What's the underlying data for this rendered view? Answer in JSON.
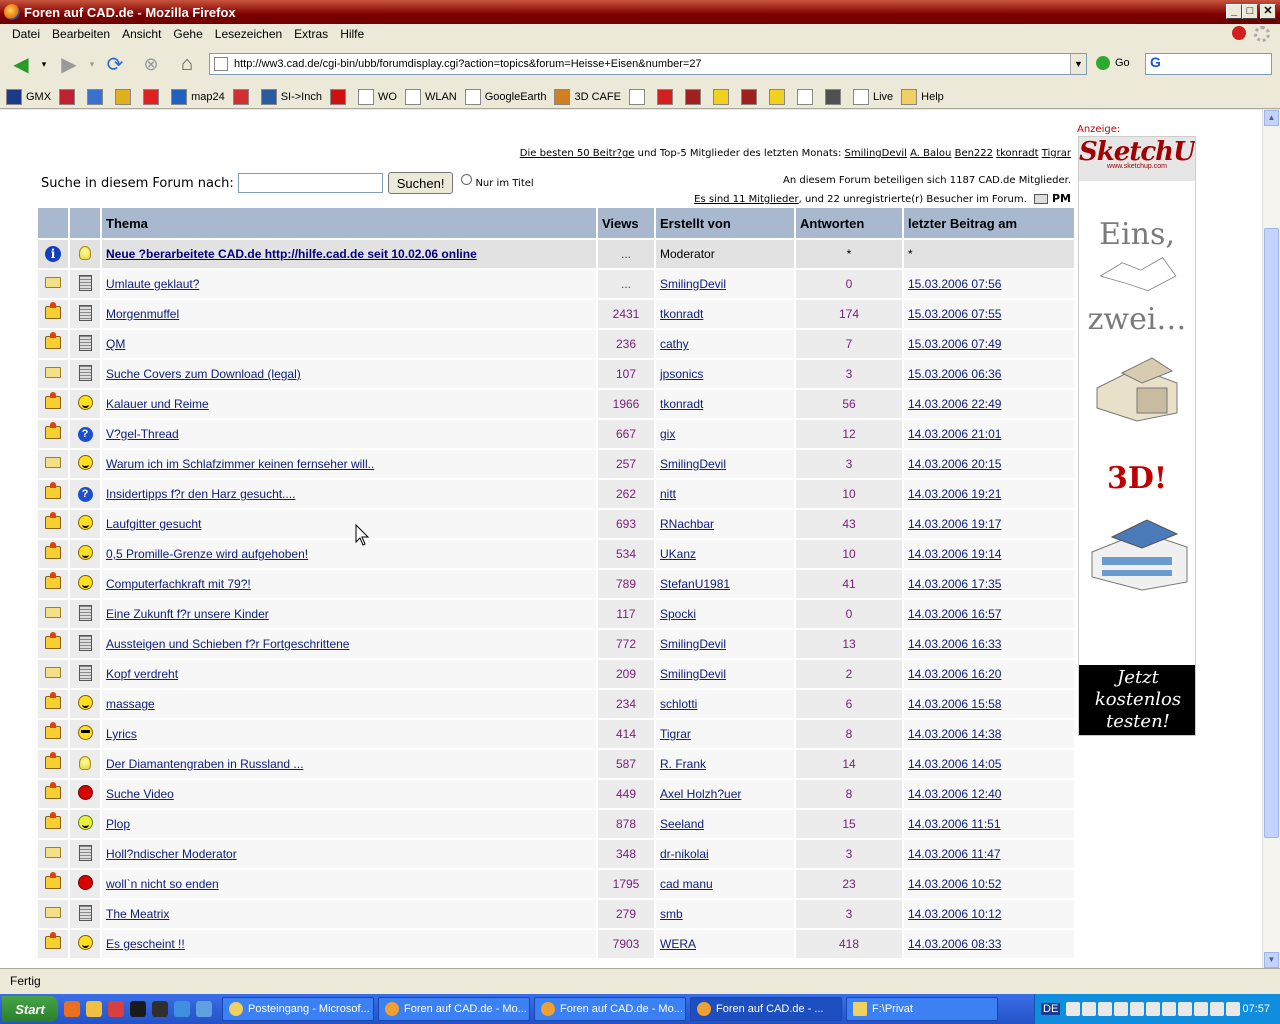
{
  "window": {
    "title": "Foren auf CAD.de - Mozilla Firefox"
  },
  "menu": [
    "Datei",
    "Bearbeiten",
    "Ansicht",
    "Gehe",
    "Lesezeichen",
    "Extras",
    "Hilfe"
  ],
  "navbar": {
    "url": "http://ww3.cad.de/cgi-bin/ubb/forumdisplay.cgi?action=topics&forum=Heisse+Eisen&number=27",
    "go_label": "Go"
  },
  "bookmarks": [
    {
      "label": "GMX",
      "icon": "gmx-icon"
    },
    {
      "label": "",
      "icon": "uk-flag-icon"
    },
    {
      "label": "",
      "icon": "google-icon"
    },
    {
      "label": "",
      "icon": "imdb-icon"
    },
    {
      "label": "",
      "icon": "sparkasse-icon"
    },
    {
      "label": "map24",
      "icon": "map24-icon"
    },
    {
      "label": "",
      "icon": "ebay-icon"
    },
    {
      "label": "SI->Inch",
      "icon": "si-icon"
    },
    {
      "label": "",
      "icon": "db-icon"
    },
    {
      "label": "WO",
      "icon": "page-icon"
    },
    {
      "label": "WLAN",
      "icon": "page-icon"
    },
    {
      "label": "GoogleEarth",
      "icon": "page-icon"
    },
    {
      "label": "3D CAFE",
      "icon": "3dcafe-icon"
    },
    {
      "label": "",
      "icon": "wikipedia-icon"
    },
    {
      "label": "",
      "icon": "bb-icon"
    },
    {
      "label": "",
      "icon": "film-icon"
    },
    {
      "label": "",
      "icon": "smiley-icon"
    },
    {
      "label": "",
      "icon": "film-icon"
    },
    {
      "label": "",
      "icon": "smiley-icon"
    },
    {
      "label": "",
      "icon": "page-icon"
    },
    {
      "label": "",
      "icon": "scan-icon"
    },
    {
      "label": "Live",
      "icon": "page-icon"
    },
    {
      "label": "Help",
      "icon": "folder-icon"
    }
  ],
  "forum": {
    "top_link": "Die besten 50 Beitr?ge",
    "top_text": " und Top-5 Mitglieder des letzten Monats: ",
    "top_members": [
      "SmilingDevil",
      "A. Balou",
      "Ben222",
      "tkonradt",
      "Tigrar"
    ],
    "online_line1": "An diesem Forum beteiligen sich 1187 CAD.de Mitglieder.",
    "online_link": "Es sind 11 Mitglieder",
    "online_rest": ", und 22 unregistrierte(r) Besucher im Forum.",
    "pm_label": "PM",
    "search_label": "Suche in diesem Forum nach:",
    "search_value": "",
    "search_button": "Suchen!",
    "title_only_label": "Nur im Titel",
    "columns": {
      "topic": "Thema",
      "views": "Views",
      "author": "Erstellt von",
      "replies": "Antworten",
      "last": "letzter Beitrag am"
    },
    "rows": [
      {
        "icon": "info-icon",
        "icon2": "bulb-icon",
        "title": "Neue ?berarbeitete CAD.de http://hilfe.cad.de seit 10.02.06 online",
        "views": "...",
        "author": "Moderator",
        "replies": "*",
        "last": "*",
        "announce": true
      },
      {
        "icon": "folder-icon",
        "icon2": "document-icon",
        "title": "Umlaute geklaut?",
        "views": "...",
        "author": "SmilingDevil",
        "replies": "0",
        "last": "15.03.2006 07:56"
      },
      {
        "icon": "hot-folder-icon",
        "icon2": "document-icon",
        "title": "Morgenmuffel",
        "views": "2431",
        "author": "tkonradt",
        "replies": "174",
        "last": "15.03.2006 07:55"
      },
      {
        "icon": "hot-folder-icon",
        "icon2": "document-icon",
        "title": "QM",
        "views": "236",
        "author": "cathy",
        "replies": "7",
        "last": "15.03.2006 07:49"
      },
      {
        "icon": "folder-icon",
        "icon2": "document-icon",
        "title": "Suche Covers zum Download (legal)",
        "views": "107",
        "author": "jpsonics",
        "replies": "3",
        "last": "15.03.2006 06:36"
      },
      {
        "icon": "hot-folder-icon",
        "icon2": "smile-icon",
        "title": "Kalauer und Reime",
        "views": "1966",
        "author": "tkonradt",
        "replies": "56",
        "last": "14.03.2006 22:49"
      },
      {
        "icon": "hot-folder-icon",
        "icon2": "question-icon",
        "title": "V?gel-Thread",
        "views": "667",
        "author": "gix",
        "replies": "12",
        "last": "14.03.2006 21:01"
      },
      {
        "icon": "folder-icon",
        "icon2": "smile-icon",
        "title": "Warum ich im Schlafzimmer keinen fernseher will..",
        "views": "257",
        "author": "SmilingDevil",
        "replies": "3",
        "last": "14.03.2006 20:15"
      },
      {
        "icon": "hot-folder-icon",
        "icon2": "question-icon",
        "title": "Insidertipps f?r den Harz gesucht....",
        "views": "262",
        "author": "nitt",
        "replies": "10",
        "last": "14.03.2006 19:21"
      },
      {
        "icon": "hot-folder-icon",
        "icon2": "smile-icon",
        "title": "Laufgitter gesucht",
        "views": "693",
        "author": "RNachbar",
        "replies": "43",
        "last": "14.03.2006 19:17"
      },
      {
        "icon": "hot-folder-icon",
        "icon2": "smile-icon",
        "title": "0,5 Promille-Grenze wird aufgehoben!",
        "views": "534",
        "author": "UKanz",
        "replies": "10",
        "last": "14.03.2006 19:14"
      },
      {
        "icon": "hot-folder-icon",
        "icon2": "smile-icon",
        "title": "Computerfachkraft mit 79?!",
        "views": "789",
        "author": "StefanU1981",
        "replies": "41",
        "last": "14.03.2006 17:35"
      },
      {
        "icon": "folder-icon",
        "icon2": "document-icon",
        "title": "Eine Zukunft f?r unsere Kinder",
        "views": "117",
        "author": "Spocki",
        "replies": "0",
        "last": "14.03.2006 16:57"
      },
      {
        "icon": "hot-folder-icon",
        "icon2": "document-icon",
        "title": "Aussteigen und Schieben f?r Fortgeschrittene",
        "views": "772",
        "author": "SmilingDevil",
        "replies": "13",
        "last": "14.03.2006 16:33"
      },
      {
        "icon": "folder-icon",
        "icon2": "document-icon",
        "title": "Kopf verdreht",
        "views": "209",
        "author": "SmilingDevil",
        "replies": "2",
        "last": "14.03.2006 16:20"
      },
      {
        "icon": "hot-folder-icon",
        "icon2": "smile-icon",
        "title": "massage",
        "views": "234",
        "author": "schlotti",
        "replies": "6",
        "last": "14.03.2006 15:58"
      },
      {
        "icon": "hot-folder-icon",
        "icon2": "cool-icon",
        "title": "Lyrics",
        "views": "414",
        "author": "Tigrar",
        "replies": "8",
        "last": "14.03.2006 14:38"
      },
      {
        "icon": "hot-folder-icon",
        "icon2": "bulb-icon",
        "title": "Der Diamantengraben in Russland ...",
        "views": "587",
        "author": "R. Frank",
        "replies": "14",
        "last": "14.03.2006 14:05"
      },
      {
        "icon": "hot-folder-icon",
        "icon2": "red-circle-icon",
        "title": "Suche Video",
        "views": "449",
        "author": "Axel Holzh?uer",
        "replies": "8",
        "last": "14.03.2006 12:40"
      },
      {
        "icon": "hot-folder-icon",
        "icon2": "green-smile-icon",
        "title": "Plop",
        "views": "878",
        "author": "Seeland",
        "replies": "15",
        "last": "14.03.2006 11:51"
      },
      {
        "icon": "folder-icon",
        "icon2": "document-icon",
        "title": "Holl?ndischer Moderator",
        "views": "348",
        "author": "dr-nikolai",
        "replies": "3",
        "last": "14.03.2006 11:47"
      },
      {
        "icon": "hot-folder-icon",
        "icon2": "red-circle-icon",
        "title": "woll`n nicht so enden",
        "views": "1795",
        "author": "cad manu",
        "replies": "23",
        "last": "14.03.2006 10:52"
      },
      {
        "icon": "folder-icon",
        "icon2": "document-icon",
        "title": "The Meatrix",
        "views": "279",
        "author": "smb",
        "replies": "3",
        "last": "14.03.2006 10:12"
      },
      {
        "icon": "hot-folder-icon",
        "icon2": "smile-icon",
        "title": "Es gescheint !!",
        "views": "7903",
        "author": "WERA",
        "replies": "418",
        "last": "14.03.2006 08:33"
      }
    ]
  },
  "ad": {
    "label": "Anzeige:",
    "brand": "SketchUp",
    "site": "www.sketchup.com",
    "word1": "Eins,",
    "word2": "zwei…",
    "word3": "3D!",
    "cta": "Jetzt kostenlos testen!"
  },
  "status": "Fertig",
  "taskbar": {
    "start": "Start",
    "tasks": [
      "Posteingang - Microsof...",
      "Foren auf CAD.de - Mo...",
      "Foren auf CAD.de - Mo...",
      "Foren auf CAD.de - ...",
      "F:\\Privat"
    ],
    "active_index": 3,
    "clock": "07:57",
    "lang": "DE"
  },
  "colors": {
    "titlebar": "#7f0000",
    "table_header": "#a8b8cf",
    "link": "#10207a",
    "count": "#7a1c7a"
  }
}
